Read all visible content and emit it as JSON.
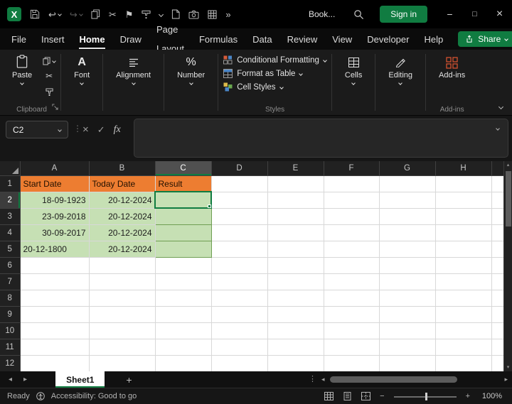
{
  "colors": {
    "accent_green": "#107C41",
    "header_fill_orange": "#ED7D31",
    "data_fill_green": "#C6E0B4"
  },
  "titlebar": {
    "document_name": "Book...",
    "sign_in_label": "Sign in"
  },
  "menu": {
    "tabs": [
      "File",
      "Insert",
      "Home",
      "Draw",
      "Page Layout",
      "Formulas",
      "Data",
      "Review",
      "View",
      "Developer",
      "Help"
    ],
    "active_tab": "Home",
    "share_label": "Share"
  },
  "ribbon": {
    "paste_label": "Paste",
    "font_label": "Font",
    "alignment_label": "Alignment",
    "number_label": "Number",
    "styles_items": [
      "Conditional Formatting",
      "Format as Table",
      "Cell Styles"
    ],
    "cells_label": "Cells",
    "editing_label": "Editing",
    "addins_label": "Add-ins",
    "group_labels": {
      "clipboard": "Clipboard",
      "styles": "Styles",
      "addins": "Add-ins"
    }
  },
  "formula_bar": {
    "name_box": "C2",
    "fx_label": "fx",
    "formula": ""
  },
  "grid": {
    "columns": [
      "A",
      "B",
      "C",
      "D",
      "E",
      "F",
      "G",
      "H"
    ],
    "visible_rows": 12,
    "selected_column": "C",
    "active_row": 2,
    "active_cell": "C2",
    "cells": {
      "A1": "Start Date",
      "B1": "Today Date",
      "C1": "Result",
      "A2": "18-09-1923",
      "B2": "20-12-2024",
      "A3": "23-09-2018",
      "B3": "20-12-2024",
      "A4": "30-09-2017",
      "B4": "20-12-2024",
      "A5": "20-12-1800",
      "B5": "20-12-2024"
    }
  },
  "sheet_bar": {
    "active_tab": "Sheet1"
  },
  "status_bar": {
    "mode": "Ready",
    "accessibility": "Accessibility: Good to go",
    "zoom": "100%"
  },
  "icons": {
    "undo": "↩",
    "redo": "↪",
    "cut": "✂",
    "flag": "⚑",
    "more": "»",
    "dots_v": "⋮",
    "check": "✓",
    "cancel": "×",
    "minimize": "−",
    "maximize": "□",
    "close": "×",
    "prev": "◂",
    "next": "▸",
    "up": "▴",
    "down": "▾",
    "plus": "+",
    "minus": "−",
    "percent": "%",
    "font_a": "A"
  }
}
